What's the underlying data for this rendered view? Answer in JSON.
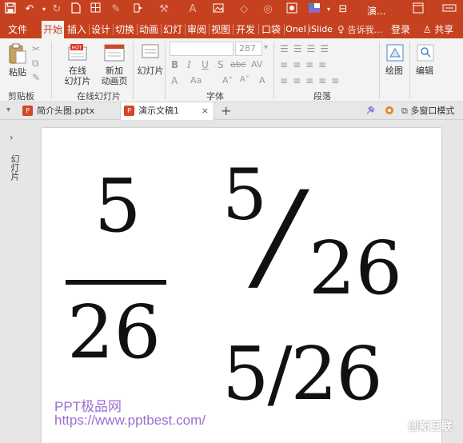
{
  "window": {
    "title": "演...",
    "accent_color": "#c6411f",
    "quick_access_icons": [
      "save-icon",
      "undo-icon",
      "redo-icon",
      "new-icon",
      "grid-icon",
      "pen-icon",
      "format-icon",
      "brush-icon",
      "font-color-icon",
      "image-icon",
      "shape-icon",
      "select-icon",
      "color-icon",
      "chevron-down-icon"
    ],
    "controls": [
      "restore-icon",
      "close-icon"
    ]
  },
  "menu": {
    "tabs": [
      {
        "label": "文件"
      },
      {
        "label": "开始",
        "active": true
      },
      {
        "label": "插入"
      },
      {
        "label": "设计"
      },
      {
        "label": "切换"
      },
      {
        "label": "动画"
      },
      {
        "label": "幻灯"
      },
      {
        "label": "审阅"
      },
      {
        "label": "视图"
      },
      {
        "label": "开发"
      },
      {
        "label": "口袋"
      },
      {
        "label": "OneI"
      },
      {
        "label": "iSlide"
      }
    ],
    "tell_me": "告诉我...",
    "login": "登录",
    "share": "共享"
  },
  "ribbon": {
    "paste_label": "粘贴",
    "clipboard_group": "剪贴板",
    "online_slide_label": "在线\n幻灯片",
    "online_slide_sub": "▾",
    "new_anim_label": "新加\n动画页",
    "online_group": "在线幻灯片",
    "slides_label": "幻灯片",
    "font_size": "287",
    "font_group": "字体",
    "paragraph_group": "段落",
    "draw_label": "绘图",
    "edit_label": "编辑"
  },
  "doc_tabs": [
    {
      "label": "简介头图.pptx"
    },
    {
      "label": "演示文稿1",
      "active": true
    }
  ],
  "doc_tab_right": {
    "multi_window": "多窗口模式"
  },
  "left_pane": {
    "label": "幻灯片"
  },
  "slide": {
    "stacked_numerator": "5",
    "stacked_denominator": "26",
    "skewed_numerator": "5",
    "skewed_slash": "/",
    "skewed_denominator": "26",
    "linear": "5/26",
    "watermark_line1": "PPT极品网",
    "watermark_line2": "https://www.pptbest.com/"
  },
  "brand": {
    "name": "创新互联"
  }
}
